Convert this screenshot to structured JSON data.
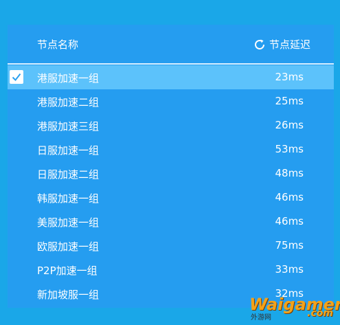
{
  "header": {
    "name_label": "节点名称",
    "latency_label": "节点延迟"
  },
  "nodes": [
    {
      "name": "港服加速一组",
      "latency": "23ms",
      "selected": true
    },
    {
      "name": "港服加速二组",
      "latency": "25ms",
      "selected": false
    },
    {
      "name": "港服加速三组",
      "latency": "26ms",
      "selected": false
    },
    {
      "name": "日服加速一组",
      "latency": "53ms",
      "selected": false
    },
    {
      "name": "日服加速二组",
      "latency": "48ms",
      "selected": false
    },
    {
      "name": "韩服加速一组",
      "latency": "46ms",
      "selected": false
    },
    {
      "name": "美服加速一组",
      "latency": "46ms",
      "selected": false
    },
    {
      "name": "欧服加速一组",
      "latency": "75ms",
      "selected": false
    },
    {
      "name": "P2P加速一组",
      "latency": "33ms",
      "selected": false
    },
    {
      "name": "新加坡服一组",
      "latency": "32ms",
      "selected": false
    }
  ],
  "watermark": {
    "main": "Waigamer",
    "com": ".com",
    "sub": "外游网"
  },
  "colors": {
    "frame": "#1aa7e8",
    "panel": "#259df0",
    "selected_row": "#5cc2fb",
    "text": "#ffffff",
    "watermark": "#f2a21a"
  },
  "icons": {
    "refresh": "refresh-icon",
    "check": "check-icon"
  }
}
